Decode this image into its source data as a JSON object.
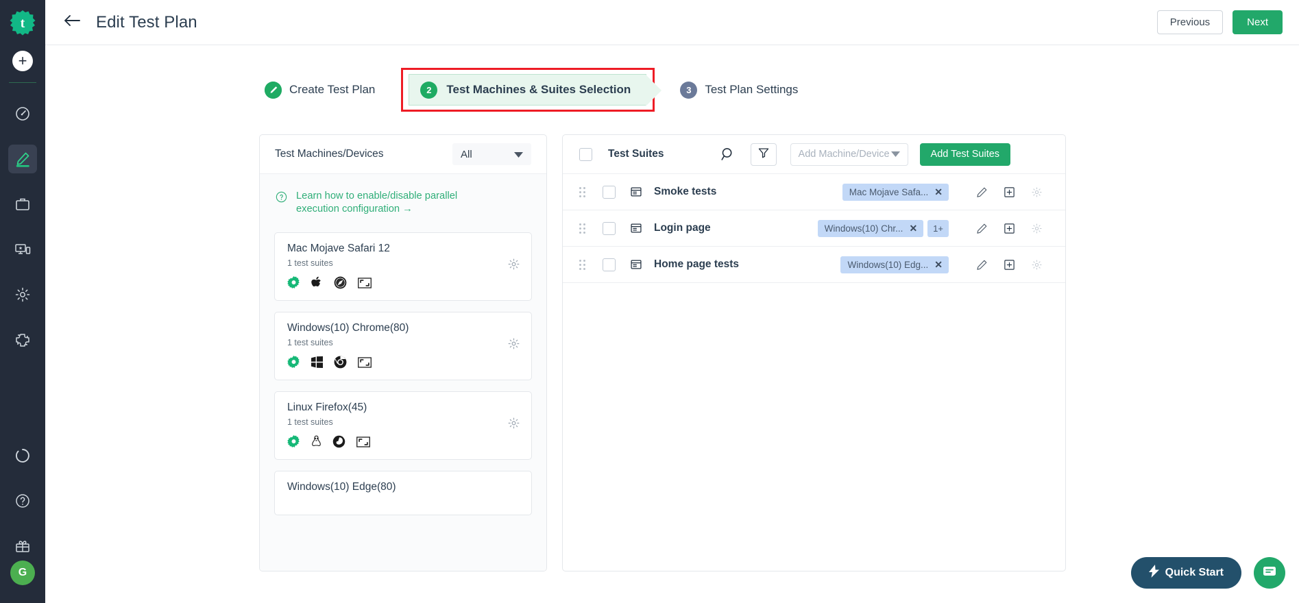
{
  "brand": {
    "accent": "#22a86a",
    "dark": "#242c3a",
    "highlight": "#ee1c25",
    "chip": "#c2d8f7"
  },
  "rail": {
    "logo_icon": "testsigma-logo-icon",
    "add_label": "+",
    "items": [
      {
        "name": "dashboard",
        "icon": "speedometer-icon"
      },
      {
        "name": "test-development",
        "icon": "pencil-icon",
        "active": true
      },
      {
        "name": "test-plans",
        "icon": "briefcase-icon"
      },
      {
        "name": "test-lab",
        "icon": "devices-icon"
      },
      {
        "name": "settings",
        "icon": "gear-icon"
      },
      {
        "name": "addons",
        "icon": "puzzle-icon"
      },
      {
        "name": "usage",
        "icon": "donut-icon"
      },
      {
        "name": "help",
        "icon": "question-circle-icon"
      },
      {
        "name": "whats-new",
        "icon": "gift-icon"
      }
    ],
    "avatar_initial": "G"
  },
  "topbar": {
    "back_icon": "arrow-left-icon",
    "title": "Edit Test Plan",
    "previous_label": "Previous",
    "next_label": "Next"
  },
  "stepper": {
    "steps": [
      {
        "number": "",
        "label": "Create Test Plan",
        "state": "done",
        "icon": "pencil-check-icon"
      },
      {
        "number": "2",
        "label": "Test Machines & Suites Selection",
        "state": "current",
        "highlighted": true
      },
      {
        "number": "3",
        "label": "Test Plan Settings",
        "state": "todo"
      }
    ]
  },
  "left_panel": {
    "title": "Test Machines/Devices",
    "filter_value": "All",
    "filter_caret_icon": "caret-down-icon",
    "help_icon": "question-circle-icon",
    "learn_link": "Learn how to enable/disable parallel execution configuration →",
    "machines": [
      {
        "name": "Mac Mojave Safari 12",
        "suites": "1 test suites",
        "icons": [
          "gear-green-icon",
          "apple-icon",
          "safari-icon",
          "resolution-icon"
        ],
        "settings_icon": "gear-icon"
      },
      {
        "name": "Windows(10) Chrome(80)",
        "suites": "1 test suites",
        "icons": [
          "gear-green-icon",
          "windows-icon",
          "chrome-icon",
          "resolution-icon"
        ],
        "settings_icon": "gear-icon"
      },
      {
        "name": "Linux Firefox(45)",
        "suites": "1 test suites",
        "icons": [
          "gear-green-icon",
          "linux-icon",
          "firefox-icon",
          "resolution-icon"
        ],
        "settings_icon": "gear-icon"
      },
      {
        "name": "Windows(10) Edge(80)",
        "suites": "",
        "icons": [],
        "settings_icon": "gear-icon"
      }
    ]
  },
  "right_panel": {
    "title": "Test Suites",
    "search_icon": "search-icon",
    "filter_icon": "funnel-icon",
    "machine_select_placeholder": "Add Machine/Device",
    "machine_select_caret_icon": "caret-down-icon",
    "add_button_label": "Add Test Suites",
    "rows": [
      {
        "drag_icon": "drag-handle-icon",
        "type_icon": "test-suite-icon",
        "name": "Smoke tests",
        "chips": [
          {
            "label": "Mac Mojave Safa...",
            "remove_icon": "close-icon"
          }
        ],
        "extra_count": "",
        "actions": [
          "pencil-icon",
          "add-box-icon",
          "gear-icon"
        ]
      },
      {
        "drag_icon": "drag-handle-icon",
        "type_icon": "test-suite-icon",
        "name": "Login page",
        "chips": [
          {
            "label": "Windows(10) Chr...",
            "remove_icon": "close-icon"
          }
        ],
        "extra_count": "1+",
        "actions": [
          "pencil-icon",
          "add-box-icon",
          "gear-icon"
        ]
      },
      {
        "drag_icon": "drag-handle-icon",
        "type_icon": "test-suite-icon",
        "name": "Home page tests",
        "chips": [
          {
            "label": "Windows(10) Edg...",
            "remove_icon": "close-icon"
          }
        ],
        "extra_count": "",
        "actions": [
          "pencil-icon",
          "add-box-icon",
          "gear-icon"
        ]
      }
    ]
  },
  "floating": {
    "quick_start_label": "Quick Start",
    "quick_start_icon": "lightning-icon",
    "chat_icon": "chat-bubble-icon"
  }
}
